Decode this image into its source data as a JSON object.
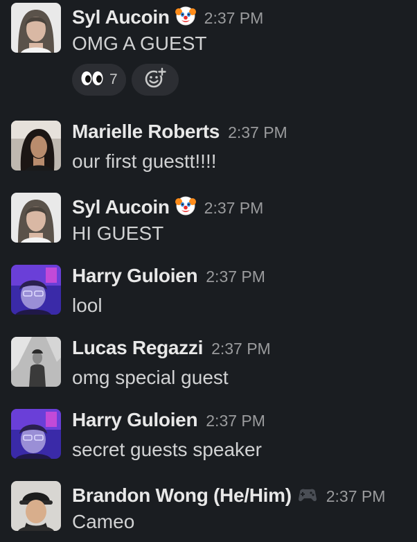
{
  "messages": [
    {
      "author": "Syl Aucoin",
      "status_icon": "clown-face-icon",
      "time": "2:37 PM",
      "text": "OMG A GUEST",
      "reactions": [
        {
          "icon": "eyes-emoji-icon",
          "count": "7"
        }
      ],
      "add_reaction_icon": "add-reaction-icon"
    },
    {
      "author": "Marielle Roberts",
      "time": "2:37 PM",
      "text": "our first guestt!!!!"
    },
    {
      "author": "Syl Aucoin",
      "status_icon": "clown-face-icon",
      "time": "2:37 PM",
      "text": "HI GUEST"
    },
    {
      "author": "Harry Guloien",
      "time": "2:37 PM",
      "text": "lool"
    },
    {
      "author": "Lucas Regazzi",
      "time": "2:37 PM",
      "text": "omg special guest"
    },
    {
      "author": "Harry Guloien",
      "time": "2:37 PM",
      "text": "secret guests speaker"
    },
    {
      "author": "Brandon Wong (He/Him)",
      "status_icon": "game-controller-icon",
      "time": "2:37 PM",
      "text": "Cameo"
    }
  ],
  "colors": {
    "background": "#1a1d21",
    "name": "#e8e8e8",
    "text": "#d1d2d3",
    "time": "#9a9b9d",
    "reaction_bg": "#2c2e33"
  }
}
